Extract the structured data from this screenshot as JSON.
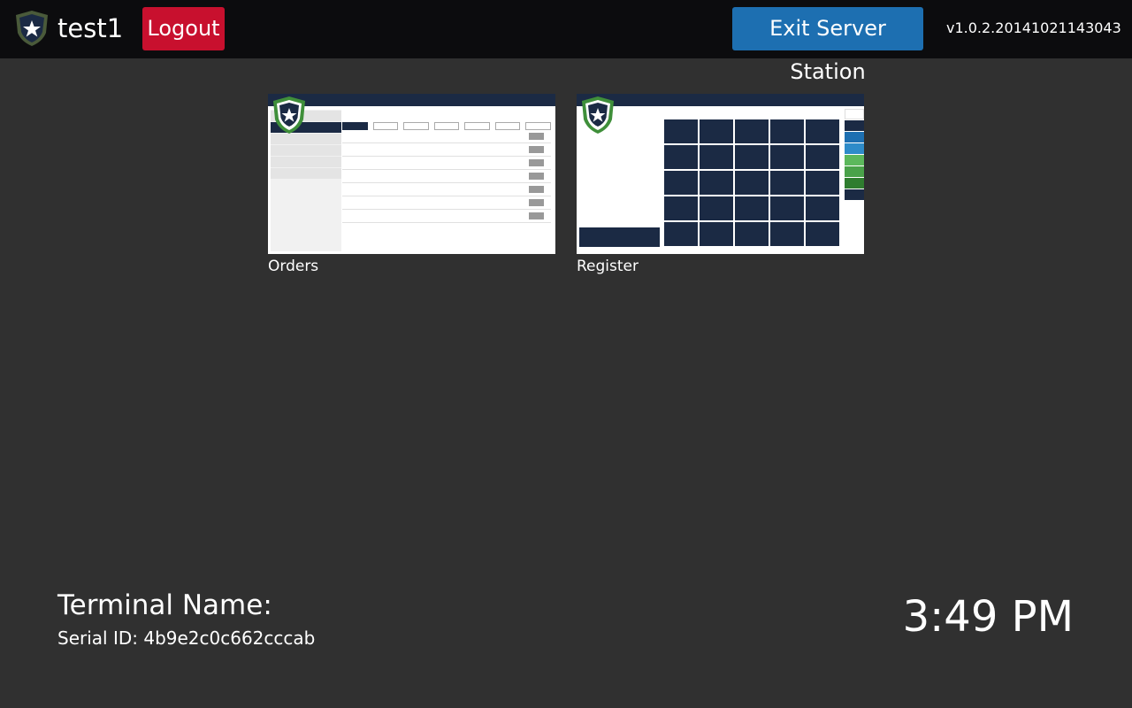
{
  "header": {
    "username": "test1",
    "logout_label": "Logout",
    "exit_label": "Exit Server Station",
    "version": "v1.0.2.20141021143043"
  },
  "apps": [
    {
      "label": "Orders"
    },
    {
      "label": "Register"
    }
  ],
  "footer": {
    "terminal_label": "Terminal Name:",
    "serial_label": "Serial ID: 4b9e2c0c662cccab",
    "time": "3:49 PM"
  },
  "colors": {
    "background": "#303030",
    "topbar": "#0c0c0e",
    "logout": "#c8102e",
    "exit": "#1d6fb1",
    "brand_navy": "#1b2a44",
    "brand_green": "#3f8f3a"
  },
  "icons": {
    "logo": "shield-star-icon"
  }
}
